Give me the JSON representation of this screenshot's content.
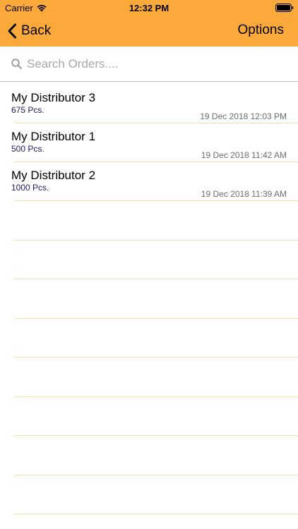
{
  "status_bar": {
    "carrier": "Carrier",
    "time": "12:32 PM"
  },
  "nav": {
    "back_label": "Back",
    "options_label": "Options"
  },
  "search": {
    "placeholder": "Search Orders...."
  },
  "orders": [
    {
      "name": "My Distributor 3",
      "quantity": "675 Pcs.",
      "date": "19 Dec 2018 12:03 PM"
    },
    {
      "name": "My Distributor 1",
      "quantity": "500 Pcs.",
      "date": "19 Dec 2018 11:42 AM"
    },
    {
      "name": "My Distributor 2",
      "quantity": "1000 Pcs.",
      "date": "19 Dec 2018 11:39 AM"
    }
  ],
  "colors": {
    "nav_background": "#fba93a",
    "quantity_text": "#1f1c73",
    "separator": "#f8dfb2"
  },
  "icons": [
    "wifi-icon",
    "battery-icon",
    "chevron-left-icon",
    "search-icon"
  ]
}
